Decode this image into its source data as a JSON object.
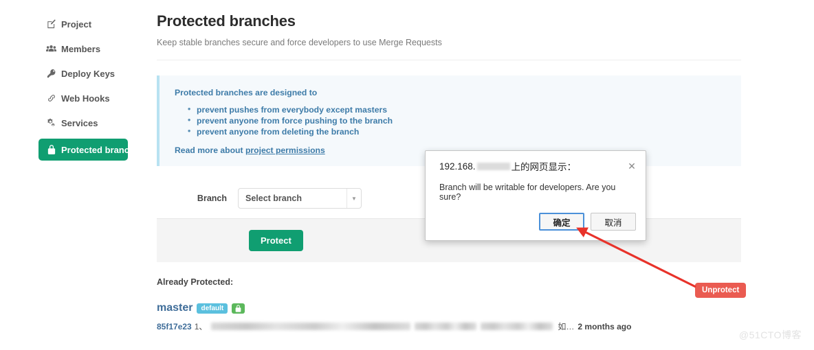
{
  "sidebar": {
    "items": [
      {
        "label": "Project",
        "icon": "pencil-square-icon",
        "active": false
      },
      {
        "label": "Members",
        "icon": "users-icon",
        "active": false
      },
      {
        "label": "Deploy Keys",
        "icon": "key-icon",
        "active": false
      },
      {
        "label": "Web Hooks",
        "icon": "link-icon",
        "active": false
      },
      {
        "label": "Services",
        "icon": "cogs-icon",
        "active": false
      },
      {
        "label": "Protected branches",
        "icon": "lock-icon",
        "active": true
      }
    ]
  },
  "header": {
    "title": "Protected branches",
    "subtitle": "Keep stable branches secure and force developers to use Merge Requests"
  },
  "info_panel": {
    "heading": "Protected branches are designed to",
    "bullets": [
      "prevent pushes from everybody except masters",
      "prevent anyone from force pushing to the branch",
      "prevent anyone from deleting the branch"
    ],
    "footer_prefix": "Read more about ",
    "footer_link": "project permissions"
  },
  "form": {
    "branch_label": "Branch",
    "branch_select_value": "Select branch",
    "caret_icon": "chevron-down-icon",
    "protect_button": "Protect"
  },
  "already_protected": {
    "title": "Already Protected:",
    "branch_name": "master",
    "badge_default": "default",
    "badge_lock_icon": "lock-icon",
    "commit_sha": "85f17e23",
    "commit_prefix": "1、",
    "commit_tail": "如…",
    "commit_time": "2 months ago",
    "unprotect_button": "Unprotect"
  },
  "modal": {
    "title_prefix": "192.168.",
    "title_suffix": "上的网页显示：",
    "close_icon": "close-icon",
    "message": "Branch will be writable for developers. Are you sure?",
    "confirm_button": "确定",
    "cancel_button": "取消"
  },
  "annotation": {
    "arrow_color": "#e8322a"
  },
  "watermark": "@51CTO博客",
  "colors": {
    "accent_green": "#109e71",
    "danger_red": "#ea5b51",
    "info_blue": "#3d7ba8",
    "badge_default": "#5bc0de",
    "badge_lock": "#5cb85c",
    "focus_blue": "#4a90d9"
  }
}
